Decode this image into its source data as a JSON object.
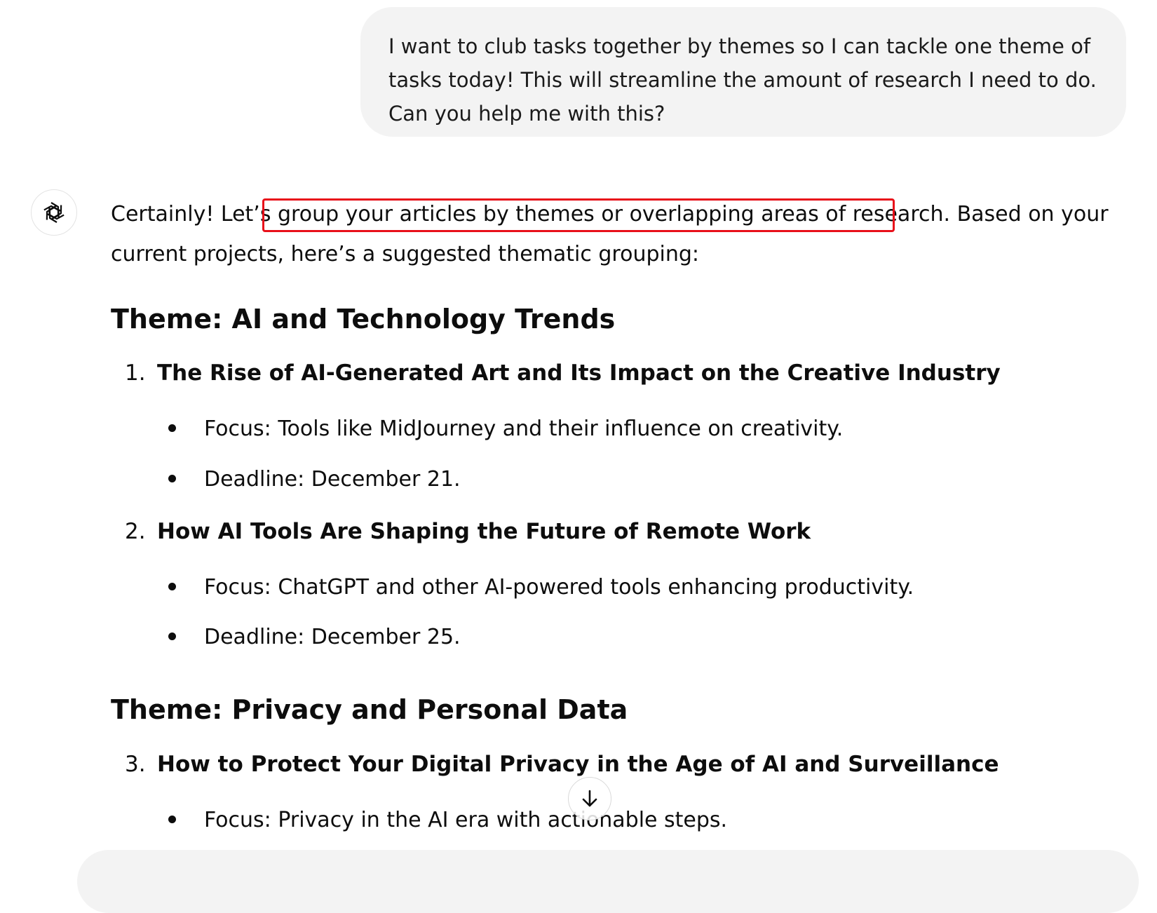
{
  "user_message": {
    "lines": [
      "I want to club tasks together by themes so I can tackle one theme of",
      "tasks today! This will streamline the amount of research I need to do.",
      "Can you help me with this?"
    ]
  },
  "assistant": {
    "avatar_icon": "openai-logo-icon",
    "intro": {
      "line1_pre": "Certainly! Let’s ",
      "line1_highlight": "group your articles by themes or overlapping areas of research",
      "line1_post": ". Based on your",
      "line2": "current projects, here’s a suggested thematic grouping:"
    },
    "highlight_color": "#e8101a",
    "themes": [
      {
        "heading": "Theme: AI and Technology Trends",
        "items": [
          {
            "number": "1.",
            "title": "The Rise of AI-Generated Art and Its Impact on the Creative Industry",
            "bullets": [
              "Focus: Tools like MidJourney and their influence on creativity.",
              "Deadline: December 21."
            ]
          },
          {
            "number": "2.",
            "title": "How AI Tools Are Shaping the Future of Remote Work",
            "bullets": [
              "Focus: ChatGPT and other AI-powered tools enhancing productivity.",
              "Deadline: December 25."
            ]
          }
        ]
      },
      {
        "heading": "Theme: Privacy and Personal Data",
        "items": [
          {
            "number": "3.",
            "title": "How to Protect Your Digital Privacy in the Age of AI and Surveillance",
            "bullets": [
              "Focus: Privacy in the AI era with actionable steps."
            ]
          }
        ]
      }
    ]
  },
  "scroll_down_icon": "arrow-down-icon"
}
